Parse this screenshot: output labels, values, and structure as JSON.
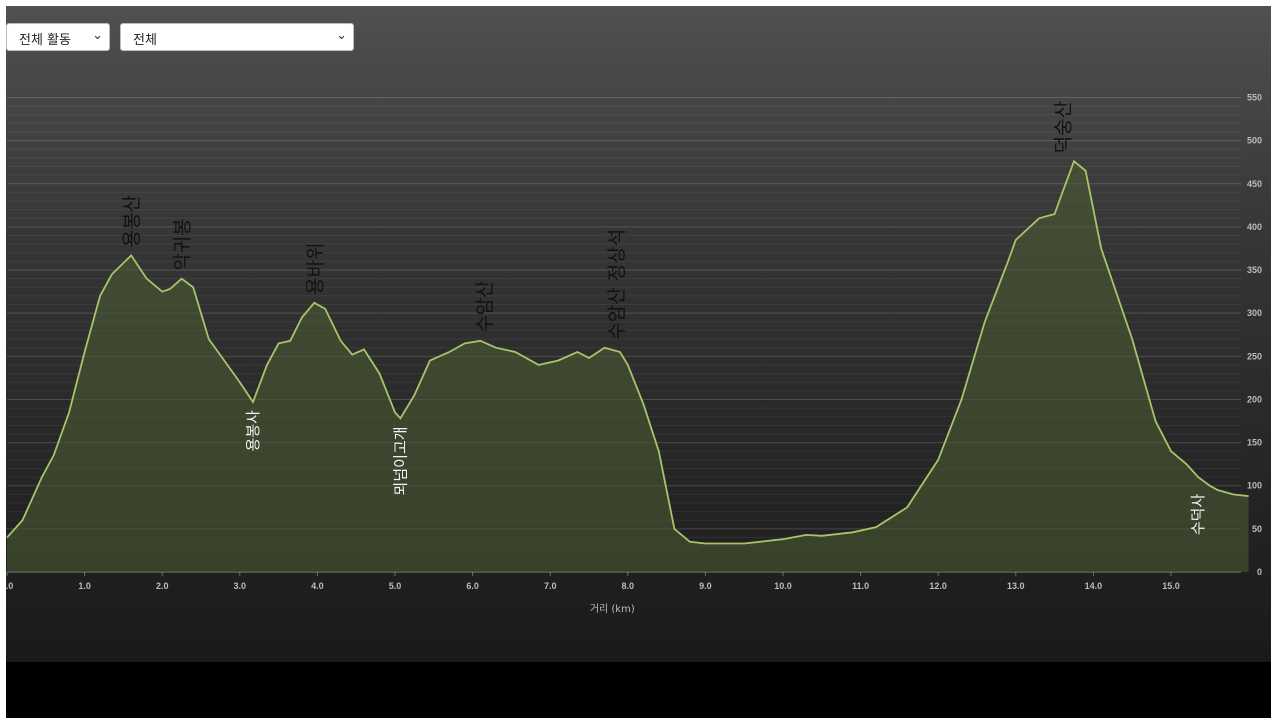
{
  "controls": {
    "activity_select": "전체 활동",
    "range_select": "전체"
  },
  "chart_data": {
    "type": "area",
    "xlabel": "거리 (km)",
    "ylabel": "",
    "xlim": [
      0,
      16
    ],
    "ylim": [
      0,
      550
    ],
    "x_ticks": [
      0,
      1,
      2,
      3,
      4,
      5,
      6,
      7,
      8,
      9,
      10,
      11,
      12,
      13,
      14,
      15
    ],
    "x_tick_labels": [
      "0.0",
      "1.0",
      "2.0",
      "3.0",
      "4.0",
      "5.0",
      "6.0",
      "7.0",
      "8.0",
      "9.0",
      "10.0",
      "11.0",
      "12.0",
      "13.0",
      "14.0",
      "15.0"
    ],
    "y_ticks": [
      0,
      50,
      100,
      150,
      200,
      250,
      300,
      350,
      400,
      450,
      500,
      550
    ],
    "grid": true,
    "line_color": "#a8c46a",
    "fill_color": "#4a5a32",
    "series": [
      {
        "x": [
          0,
          0.2,
          0.45,
          0.6,
          0.8,
          1.0,
          1.2,
          1.35,
          1.6,
          1.8,
          2.0,
          2.1,
          2.25,
          2.4,
          2.6,
          2.8,
          3.0,
          3.17,
          3.35,
          3.5,
          3.65,
          3.8,
          3.96,
          4.1,
          4.3,
          4.45,
          4.6,
          4.8,
          5.0,
          5.07,
          5.25,
          5.45,
          5.7,
          5.9,
          6.1,
          6.3,
          6.55,
          6.85,
          7.1,
          7.35,
          7.5,
          7.7,
          7.9,
          8.0,
          8.2,
          8.4,
          8.6,
          8.8,
          9.0,
          9.5,
          10.0,
          10.3,
          10.5,
          10.9,
          11.2,
          11.6,
          12.0,
          12.3,
          12.6,
          12.9,
          13.0,
          13.3,
          13.5,
          13.6,
          13.75,
          13.9,
          14.1,
          14.5,
          14.8,
          15.0,
          15.2,
          15.35,
          15.5,
          15.6,
          15.8,
          16.0
        ],
        "y": [
          40,
          60,
          110,
          135,
          185,
          255,
          320,
          345,
          367,
          340,
          325,
          328,
          340,
          330,
          270,
          245,
          220,
          197,
          240,
          265,
          268,
          295,
          312,
          305,
          268,
          252,
          258,
          230,
          185,
          178,
          205,
          245,
          255,
          265,
          268,
          260,
          255,
          240,
          245,
          255,
          248,
          260,
          255,
          240,
          195,
          140,
          50,
          35,
          33,
          33,
          38,
          43,
          42,
          46,
          52,
          75,
          130,
          200,
          290,
          360,
          385,
          410,
          415,
          440,
          476,
          465,
          375,
          270,
          175,
          140,
          125,
          110,
          100,
          95,
          90,
          88
        ]
      }
    ],
    "peak_labels": [
      {
        "text": "용봉산",
        "x": 1.6,
        "y": 367
      },
      {
        "text": "악귀봉",
        "x": 2.25,
        "y": 340
      },
      {
        "text": "용바위",
        "x": 3.96,
        "y": 312
      },
      {
        "text": "수암산",
        "x": 6.15,
        "y": 268
      },
      {
        "text": "수암산 정상석",
        "x": 7.85,
        "y": 260
      },
      {
        "text": "덕숭산",
        "x": 13.6,
        "y": 476
      }
    ],
    "valley_labels": [
      {
        "text": "용봉사",
        "x": 3.17,
        "y": 197
      },
      {
        "text": "뫼넘이고개",
        "x": 5.07,
        "y": 178
      },
      {
        "text": "수덕사",
        "x": 15.35,
        "y": 100
      }
    ]
  }
}
